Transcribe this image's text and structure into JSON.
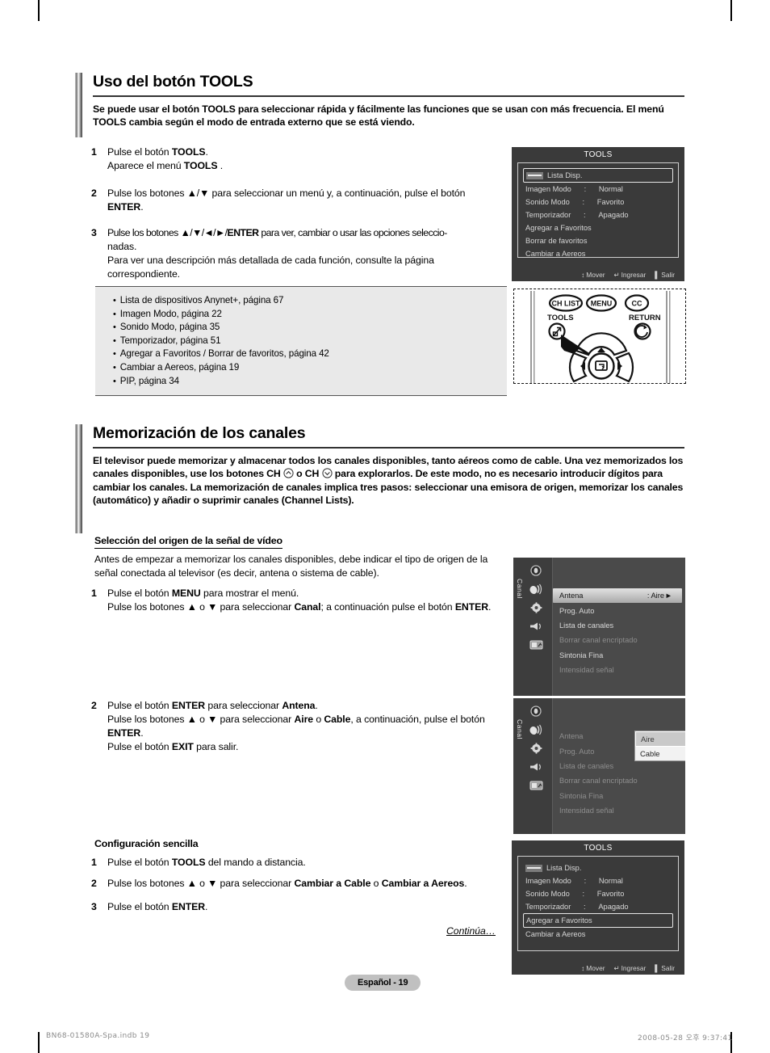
{
  "page": {
    "badge": "Español - 19",
    "continua": "Continúa…",
    "footer_left": "BN68-01580A-Spa.indb   19",
    "footer_right": "2008-05-28   오후 9:37:41"
  },
  "section1": {
    "title": "Uso del botón TOOLS",
    "intro": "Se puede usar el botón TOOLS para seleccionar rápida y fácilmente las funciones que se usan con más frecuencia. El menú TOOLS cambia según el modo de entrada externo que se está viendo.",
    "steps": [
      {
        "num": "1",
        "lines": [
          "Pulse el botón TOOLS.",
          "Aparece el menú TOOLS ."
        ]
      },
      {
        "num": "2",
        "lines": [
          "Pulse los botones ▲/▼ para seleccionar un menú y, a continuación, pulse el botón ENTER."
        ]
      },
      {
        "num": "3",
        "lines": [
          "Pulse los botones ▲/▼/◄/►/ENTER para ver, cambiar o usar las opciones seleccionadas.",
          "Para ver una descripción más detallada de cada función, consulte la página correspondiente."
        ]
      }
    ],
    "bullets": [
      "Lista de dispositivos Anynet+, página 67",
      "Imagen Modo, página 22",
      "Sonido Modo, página 35",
      "Temporizador, página 51",
      "Agregar a Favoritos / Borrar de favoritos, página 42",
      "Cambiar a Aereos, página 19",
      "PIP, página 34"
    ]
  },
  "tools_osd_top": {
    "title": "TOOLS",
    "rows": [
      {
        "label": "Lista Disp.",
        "colon": "",
        "value": "",
        "boxed": true,
        "icon": "source-icon"
      },
      {
        "label": "Imagen Modo",
        "colon": ":",
        "value": "Normal",
        "boxed": false
      },
      {
        "label": "Sonido Modo",
        "colon": ":",
        "value": "Favorito",
        "boxed": false
      },
      {
        "label": "Temporizador",
        "colon": ":",
        "value": "Apagado",
        "boxed": false
      },
      {
        "label": "Agregar a Favoritos",
        "colon": "",
        "value": "",
        "boxed": false
      },
      {
        "label": "Borrar de favoritos",
        "colon": "",
        "value": "",
        "boxed": false
      },
      {
        "label": "Cambiar a Aereos",
        "colon": "",
        "value": "",
        "boxed": false
      }
    ],
    "footer": [
      {
        "icon": "updown-icon",
        "label": "Mover"
      },
      {
        "icon": "enter-icon",
        "label": "Ingresar"
      },
      {
        "icon": "exit-icon",
        "label": "Salir"
      }
    ]
  },
  "remote": {
    "buttons": [
      "CH LIST",
      "MENU",
      "CC"
    ],
    "label_tools": "TOOLS",
    "label_return": "RETURN"
  },
  "section2": {
    "title": "Memorización de los canales",
    "intro_part1": "El televisor puede memorizar y almacenar todos los canales disponibles, tanto aéreos como de cable. Una vez memorizados los canales disponibles, use los botones CH",
    "intro_part2": "o CH",
    "intro_part3": "para explorarlos. De este modo, no es necesario introducir dígitos para cambiar los canales. La memorización de canales implica tres pasos: seleccionar una emisora de origen, memorizar los canales (automático) y añadir o suprimir canales (Channel Lists).",
    "sub_head": "Selección del origen de la señal de vídeo",
    "para": "Antes de empezar a memorizar los canales disponibles, debe indicar el tipo de origen de la señal conectada al televisor (es decir, antena o sistema de cable).",
    "steps": [
      {
        "num": "1",
        "lines": [
          "Pulse el botón MENU para mostrar el menú.",
          "Pulse los botones ▲ o ▼ para seleccionar Canal; a continuación pulse el botón ENTER."
        ]
      },
      {
        "num": "2",
        "lines": [
          "Pulse el botón ENTER para seleccionar Antena.",
          "Pulse los botones ▲ o ▼ para seleccionar Aire o Cable, a continuación, pulse el botón ENTER.",
          "Pulse el botón EXIT para salir."
        ]
      }
    ],
    "easy_head": "Configuración sencilla",
    "easy_steps": [
      {
        "num": "1",
        "lines": [
          "Pulse el botón TOOLS del mando a distancia."
        ]
      },
      {
        "num": "2",
        "lines": [
          "Pulse los botones ▲ o ▼ para seleccionar Cambiar a Cable o Cambiar a Aereos."
        ]
      },
      {
        "num": "3",
        "lines": [
          "Pulse el botón ENTER."
        ]
      }
    ]
  },
  "channel_menu_1": {
    "tab": "Canal",
    "items": [
      {
        "label": "Antena",
        "value": ": Aire",
        "state": "selected",
        "arrow": "►"
      },
      {
        "label": "Prog. Auto",
        "value": "",
        "state": "normal"
      },
      {
        "label": "Lista de canales",
        "value": "",
        "state": "normal"
      },
      {
        "label": "Borrar canal encriptado",
        "value": "",
        "state": "dim"
      },
      {
        "label": "Sintonia Fina",
        "value": "",
        "state": "normal"
      },
      {
        "label": "Intensidad señal",
        "value": "",
        "state": "dim"
      }
    ],
    "icons": [
      "picture-icon",
      "antenna-icon",
      "gear-icon",
      "speaker-icon",
      "setup-icon"
    ]
  },
  "channel_menu_2": {
    "tab": "Canal",
    "items": [
      {
        "label": "Antena",
        "value": ":",
        "state": "dim"
      },
      {
        "label": "Prog. Auto",
        "value": "",
        "state": "dim"
      },
      {
        "label": "Lista de canales",
        "value": "",
        "state": "dim"
      },
      {
        "label": "Borrar canal encriptado",
        "value": "",
        "state": "dim"
      },
      {
        "label": "Sintonia Fina",
        "value": "",
        "state": "dim"
      },
      {
        "label": "Intensidad señal",
        "value": "",
        "state": "dim"
      }
    ],
    "dropdown": {
      "options": [
        "Aire",
        "Cable"
      ],
      "selected": "Aire"
    },
    "icons": [
      "picture-icon",
      "antenna-icon",
      "gear-icon",
      "speaker-icon",
      "setup-icon"
    ]
  },
  "tools_osd_bottom": {
    "title": "TOOLS",
    "rows": [
      {
        "label": "Lista Disp.",
        "colon": "",
        "value": "",
        "boxed": false,
        "icon": "source-icon"
      },
      {
        "label": "Imagen Modo",
        "colon": ":",
        "value": "Normal",
        "boxed": false
      },
      {
        "label": "Sonido Modo",
        "colon": ":",
        "value": "Favorito",
        "boxed": false
      },
      {
        "label": "Temporizador",
        "colon": ":",
        "value": "Apagado",
        "boxed": false
      },
      {
        "label": "Agregar a Favoritos",
        "colon": "",
        "value": "",
        "boxed": true
      },
      {
        "label": "Cambiar a Aereos",
        "colon": "",
        "value": "",
        "boxed": false
      }
    ],
    "footer": [
      {
        "icon": "updown-icon",
        "label": "Mover"
      },
      {
        "icon": "enter-icon",
        "label": "Ingresar"
      },
      {
        "icon": "exit-icon",
        "label": "Salir"
      }
    ]
  }
}
